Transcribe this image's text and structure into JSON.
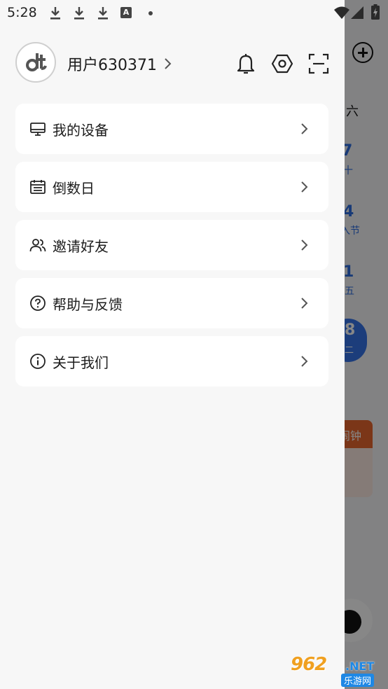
{
  "status_bar": {
    "time": "5:28",
    "icons": [
      "download-icon",
      "download-icon",
      "download-icon",
      "a-notification-icon",
      "dot-icon",
      "wifi-icon",
      "signal-icon",
      "battery-icon"
    ],
    "a_label": "A"
  },
  "background": {
    "weekday": "六",
    "day1": "7",
    "day1_sub": "十",
    "day2": "4",
    "day2_sub": "入节",
    "day3": "1",
    "day3_sub": "五",
    "day4": "8",
    "day4_sub": "二",
    "orange_label": "闹钟"
  },
  "profile": {
    "username": "用户630371",
    "avatar_icon": "dt-logo-icon"
  },
  "header_icons": [
    "bell-icon",
    "settings-hexagon-icon",
    "scan-icon"
  ],
  "menu": [
    {
      "label": "我的设备",
      "icon": "monitor-icon"
    },
    {
      "label": "倒数日",
      "icon": "calendar-icon"
    },
    {
      "label": "邀请好友",
      "icon": "users-icon"
    },
    {
      "label": "帮助与反馈",
      "icon": "help-icon"
    },
    {
      "label": "关于我们",
      "icon": "info-icon"
    }
  ],
  "watermark": {
    "brand": "962",
    "net": ".NET",
    "sub": "乐游网"
  },
  "colors": {
    "drawer_bg": "#f7f7f7",
    "card_bg": "#ffffff",
    "accent_blue": "#3574e8",
    "accent_orange": "#e8662f"
  }
}
